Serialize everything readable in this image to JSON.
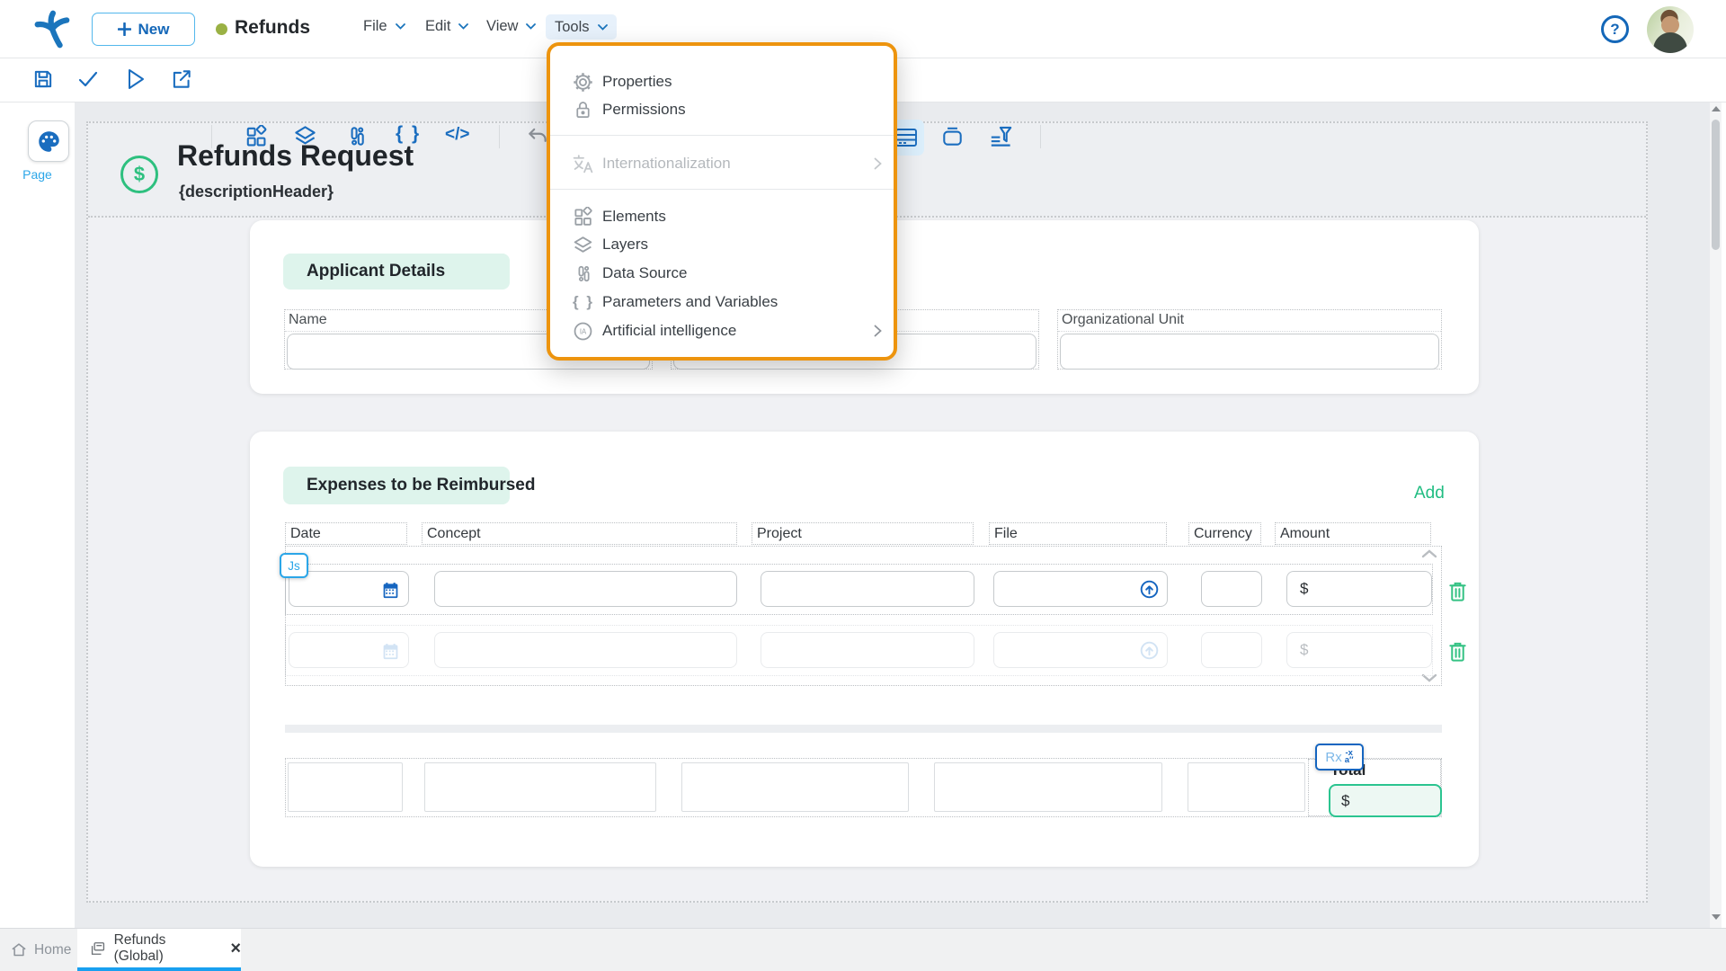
{
  "topbar": {
    "new_label": "New",
    "app_title": "Refunds",
    "menus": [
      "File",
      "Edit",
      "View",
      "Tools"
    ],
    "help_glyph": "?"
  },
  "toolbar": {
    "braces_glyph": "{ }",
    "code_glyph": "</>"
  },
  "tools_menu": {
    "items": [
      "Properties",
      "Permissions",
      "Internationalization",
      "Elements",
      "Layers",
      "Data Source",
      "Parameters and Variables",
      "Artificial intelligence"
    ],
    "ai_icon_text": "IA"
  },
  "rail": {
    "page_label": "Page"
  },
  "form_header": {
    "title": "Refunds Request",
    "subtitle": "{descriptionHeader}",
    "currency_glyph": "$"
  },
  "applicant": {
    "section_title": "Applicant Details",
    "labels": [
      "Name",
      "",
      "Organizational Unit"
    ]
  },
  "expenses": {
    "section_title": "Expenses to be Reimbursed",
    "add_label": "Add",
    "columns": [
      "Date",
      "Concept",
      "Project",
      "File",
      "Currency",
      "Amount"
    ],
    "js_badge": "Js",
    "rx_badge": "Rx",
    "rx_icon_top": "-x",
    "rx_icon_bottom": "a″",
    "dollar": "$",
    "total_label": "Total"
  },
  "tabs": {
    "home": "Home",
    "active": "Refunds (Global)",
    "close_glyph": "×"
  },
  "colors": {
    "accent_blue": "#1a6dbf",
    "light_blue": "#2ba6e8",
    "dropdown_orange": "#ED940E",
    "green": "#2EC07F",
    "mint_bg": "#def4ec",
    "add_green": "#21BD82",
    "tab_underline_blue": "#19a0f0"
  }
}
